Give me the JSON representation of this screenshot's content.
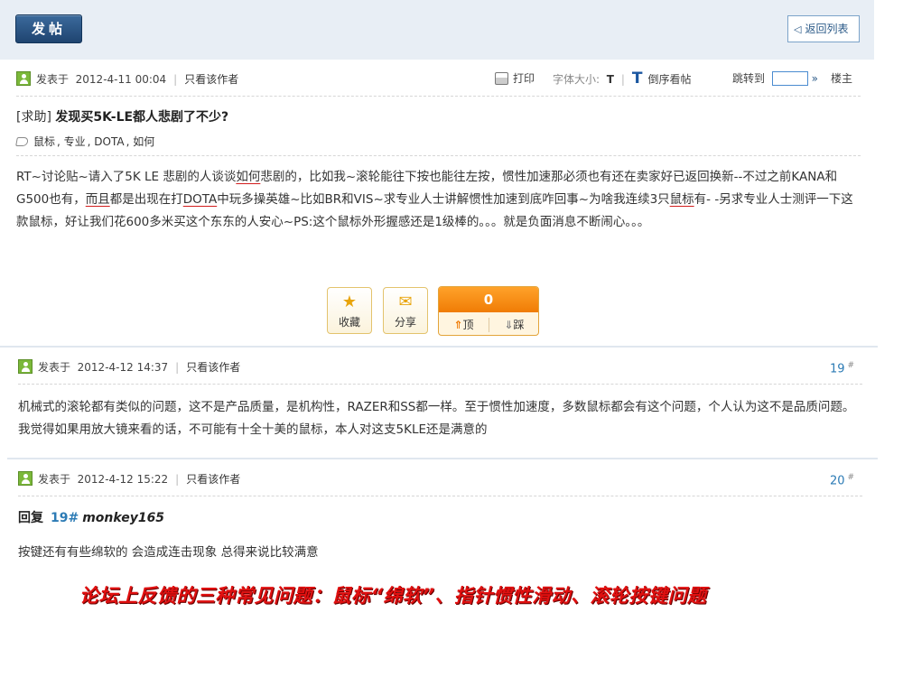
{
  "toolbar": {
    "post_label": "发帖",
    "back_label": "返回列表"
  },
  "op": {
    "posted_prefix": "发表于",
    "date": "2012-4-11 00:04",
    "only_author": "只看该作者",
    "print_label": "打印",
    "font_size_label": "字体大小:",
    "font_small": "T",
    "font_big": "T",
    "reverse_label": "倒序看帖",
    "jump_label": "跳转到",
    "jump_arrow": "»",
    "floor_label": "楼主",
    "category": "[求助]",
    "title": "发现买5K-LE都人悲剧了不少?",
    "tags": [
      "鼠标",
      ", 专业",
      ", DOTA",
      ", 如何"
    ],
    "body_parts": [
      {
        "t": "RT~讨论贴~请入了5K LE 悲剧的人谈谈",
        "u": false
      },
      {
        "t": "如何",
        "u": true
      },
      {
        "t": "悲剧的，比如我~滚轮能往下按也能往左按，惯性加速那必须也有还在卖家好已返回换新--不过之前KANA和G500也有，",
        "u": false
      },
      {
        "t": "而且",
        "u": true
      },
      {
        "t": "都是出现在打",
        "u": false
      },
      {
        "t": "DOTA",
        "u": true
      },
      {
        "t": "中玩多操英雄~比如BR和VIS~求专业人士讲解惯性加速到底咋回事~为啥我连续3只",
        "u": false
      },
      {
        "t": "鼠标",
        "u": true
      },
      {
        "t": "有- -另求专业人士测评一下这款鼠标，好让我们花600多米买这个东东的人安心~PS:这个鼠标外形握感还是1级棒的。。。就是负面消息不断闹心。。。",
        "u": false
      }
    ],
    "actions": {
      "favorite": "收藏",
      "share": "分享",
      "vote_count": "0",
      "up": "顶",
      "down": "踩"
    }
  },
  "reply19": {
    "posted_prefix": "发表于",
    "date": "2012-4-12 14:37",
    "only_author": "只看该作者",
    "floor": "19",
    "floor_mark": "#",
    "body": "机械式的滚轮都有类似的问题，这不是产品质量，是机构性，RAZER和SS都一样。至于惯性加速度，多数鼠标都会有这个问题，个人认为这不是品质问题。我觉得如果用放大镜来看的话，不可能有十全十美的鼠标，本人对这支5KLE还是满意的"
  },
  "reply20": {
    "posted_prefix": "发表于",
    "date": "2012-4-12 15:22",
    "only_author": "只看该作者",
    "floor": "20",
    "floor_mark": "#",
    "reply_word": "回复",
    "reply_floor": "19#",
    "reply_user": "monkey165",
    "body": "按键还有有些绵软的 会造成连击现象 总得来说比较满意"
  },
  "caption": "论坛上反馈的三种常见问题：鼠标“绵软”、指针惯性滑动、滚轮按键问题",
  "colors": {
    "accent_blue": "#2c7bb5",
    "highlight_red": "#e01010",
    "vote_orange": "#f07c05"
  }
}
